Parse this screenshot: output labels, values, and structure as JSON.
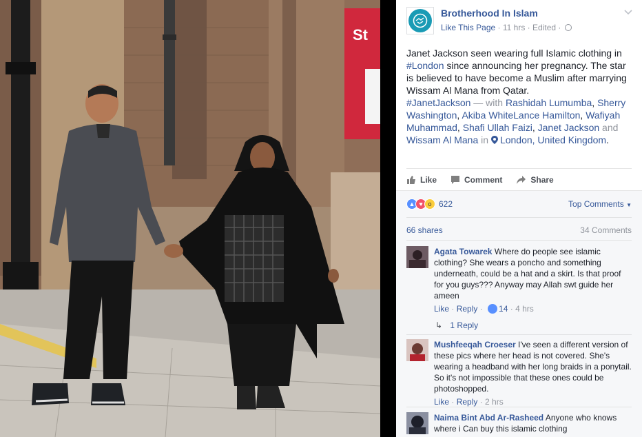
{
  "post": {
    "page_name": "Brotherhood In Islam",
    "like_page": "Like This Page",
    "time": "11 hrs",
    "edited": "Edited",
    "body_line1": "Janet Jackson seen wearing full Islamic clothing in",
    "body_hashtag_london": "#London",
    "body_line2": " since announcing her pregnancy. The star is believed to have become a Muslim after marrying Wissam Al Mana from Qatar.",
    "hashtag_janet": "#JanetJackson",
    "with_text": " — with ",
    "tagged": [
      "Rashidah Lumumba",
      "Sherry Washington",
      "Akiba WhiteLance Hamilton",
      "Wafiyah Muhammad",
      "Shafi Ullah Faizi",
      "Janet Jackson"
    ],
    "and_text": " and ",
    "last_tag": "Wissam Al Mana",
    "in_text": " in ",
    "location": "London, United Kingdom"
  },
  "actions": {
    "like": "Like",
    "comment": "Comment",
    "share": "Share"
  },
  "feedback": {
    "reaction_count": "622",
    "top_comments": "Top Comments",
    "shares": "66 shares",
    "comments_count": "34 Comments"
  },
  "comments": [
    {
      "author": "Agata Towarek",
      "text": "Where do people see islamic clothing? She wears a poncho and something underneath, could be a hat and a skirt. Is that proof for you guys??? Anyway may Allah swt guide her ameen",
      "like": "Like",
      "reply": "Reply",
      "likes": "14",
      "time": "4 hrs",
      "replies": "1 Reply"
    },
    {
      "author": "Mushfeeqah Croeser",
      "text": "I've seen a different version of these pics where her head is not covered. She's wearing a headband with her long braids in a ponytail. So it's not impossible that these ones could be photoshopped.",
      "like": "Like",
      "reply": "Reply",
      "time": "2 hrs"
    },
    {
      "author": "Naima Bint Abd Ar-Rasheed",
      "text": "Anyone who knows where i Can buy this islamic clothing"
    }
  ],
  "photo": {
    "sign_text": "St"
  },
  "colors": {
    "link": "#365899",
    "muted": "#90949c",
    "accent": "#1a9bb5"
  }
}
